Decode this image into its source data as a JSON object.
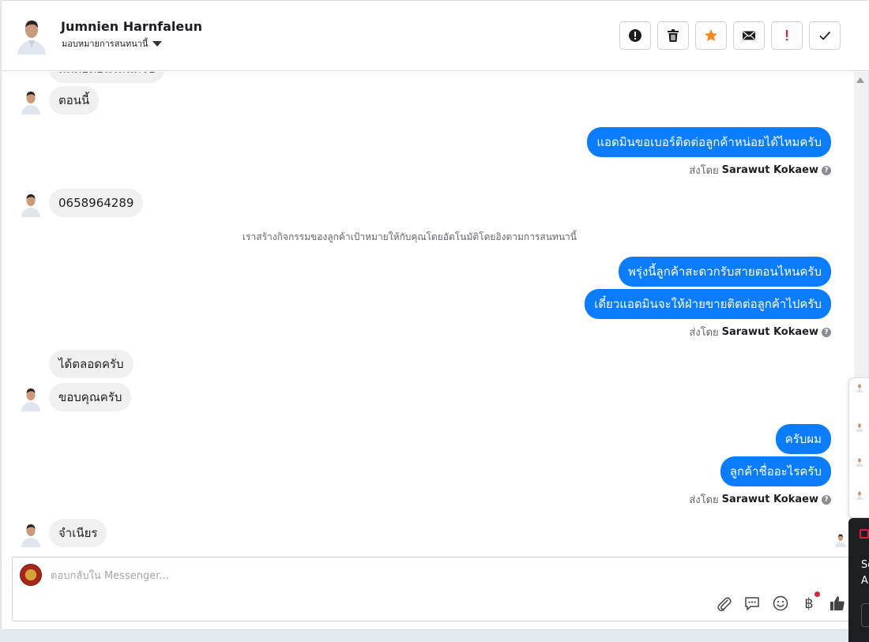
{
  "header": {
    "contact_name": "Jumnien Harnfaleun",
    "assign_label": "มอบหมายการสนทนานี้",
    "actions": [
      {
        "name": "spam-button",
        "icon": "alert-circle-icon"
      },
      {
        "name": "delete-button",
        "icon": "trash-icon"
      },
      {
        "name": "star-button",
        "icon": "star-icon"
      },
      {
        "name": "mark-unread-button",
        "icon": "mail-icon"
      },
      {
        "name": "follow-up-button",
        "icon": "exclamation-icon"
      },
      {
        "name": "done-button",
        "icon": "check-icon"
      }
    ]
  },
  "messages": {
    "partial_top": "ติดต่อตอนไหนครับ",
    "in_1": "ตอนนี้",
    "out_1": "แอดมินขอเบอร์ติดต่อลูกค้าหน่อยได้ไหมครับ",
    "sent_by_label": "ส่งโดย",
    "sent_by_name": "Sarawut Kokaew",
    "in_2": "0658964289",
    "system_note": "เราสร้างกิจกรรมของลูกค้าเป้าหมายให้กับคุณโดยอัตโนมัติโดยอิงตามการสนทนานี้",
    "out_2": "พรุ่งนี้ลูกค้าสะดวกรับสายตอนไหนครับ",
    "out_3": "เดี๋ยวแอดมินจะให้ฝ่ายขายติดต่อลูกค้าไปครับ",
    "in_3": "ได้ตลอดครับ",
    "in_4": "ขอบคุณครับ",
    "out_4": "ครับผม",
    "out_5": "ลูกค้าชื่ออะไรครับ",
    "in_5": "จำเนียร"
  },
  "composer": {
    "placeholder": "ตอบกลับใน Messenger..."
  },
  "tools": {
    "baht_symbol": "฿"
  },
  "side": {
    "t1": "Sc",
    "t2": "A"
  },
  "colors": {
    "outgoing_bubble": "#0a7cff",
    "incoming_bubble": "#f0f0f0",
    "star": "#f5891f",
    "alert_red": "#e41e3f"
  }
}
